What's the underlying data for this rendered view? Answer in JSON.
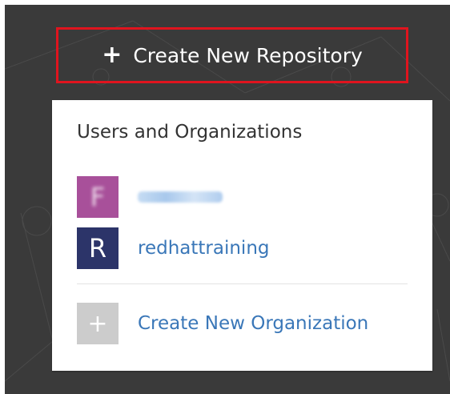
{
  "toolbar": {
    "create_repo_label": "Create New Repository",
    "plus_glyph": "+"
  },
  "menu": {
    "title": "Users and Organizations",
    "items": [
      {
        "avatar_letter": "F",
        "label": "",
        "avatar_color": "#a8509a",
        "blurred": true
      },
      {
        "avatar_letter": "R",
        "label": "redhattraining",
        "avatar_color": "#2c3469"
      }
    ],
    "create_org": {
      "icon": "+",
      "label": "Create New Organization",
      "avatar_color": "#cccccc"
    }
  },
  "colors": {
    "background": "#3a3a3a",
    "highlight_border": "#e0141e",
    "link": "#3a77b8"
  }
}
